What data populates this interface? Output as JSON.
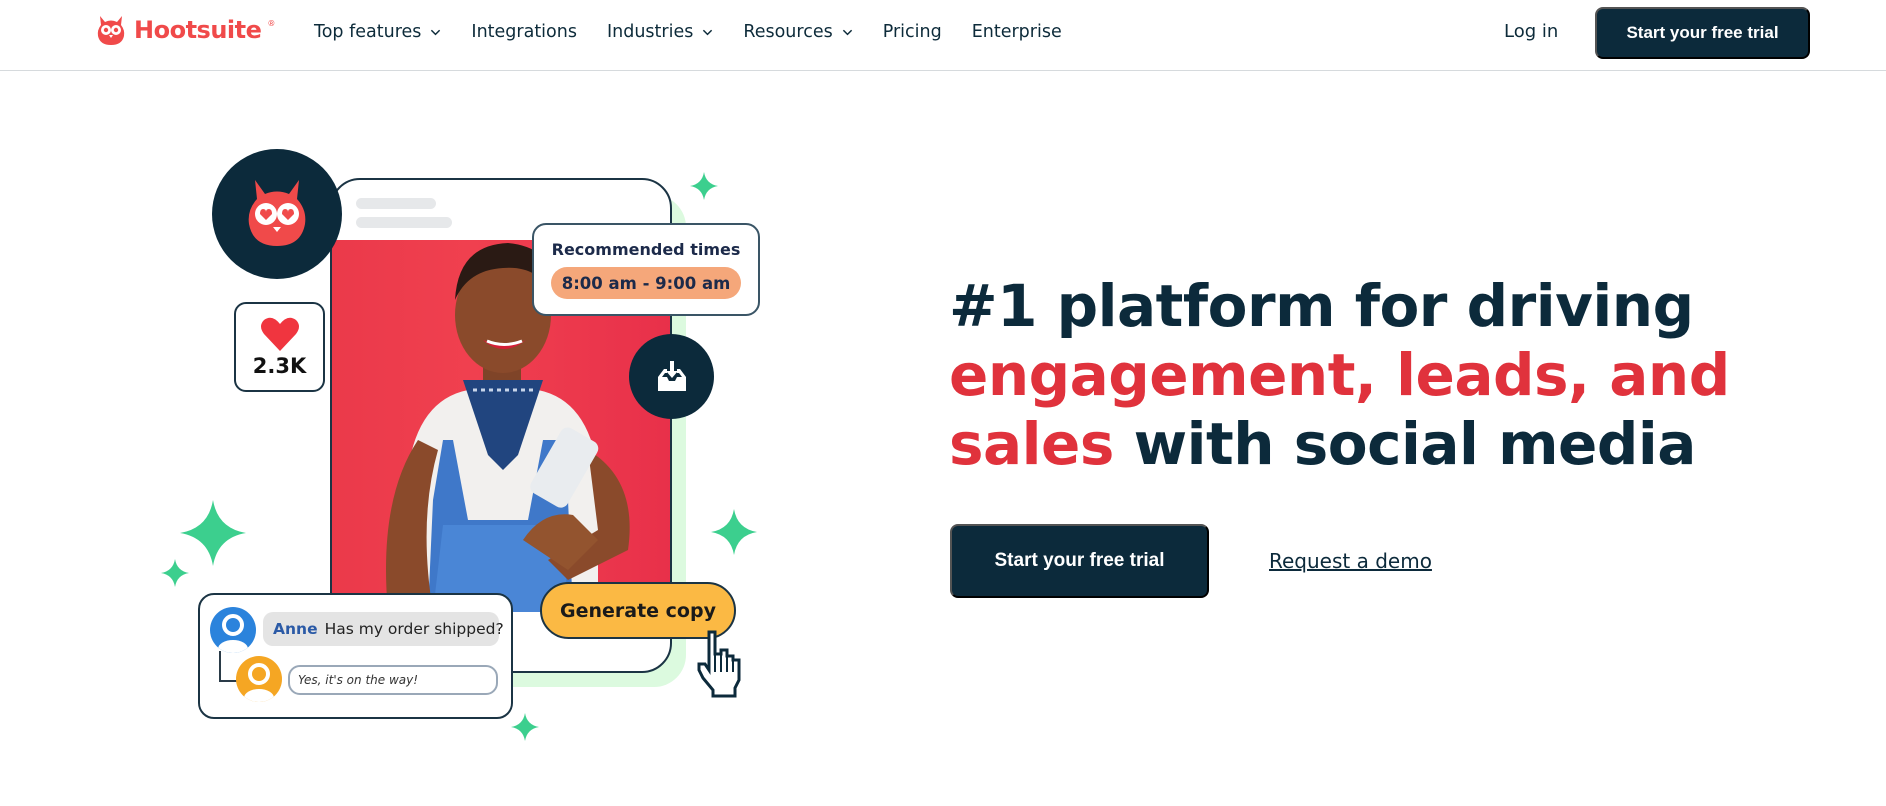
{
  "header": {
    "logo_text": "Hootsuite",
    "logo_mark": "®",
    "nav": [
      {
        "label": "Top features",
        "has_dropdown": true
      },
      {
        "label": "Integrations",
        "has_dropdown": false
      },
      {
        "label": "Industries",
        "has_dropdown": true
      },
      {
        "label": "Resources",
        "has_dropdown": true
      },
      {
        "label": "Pricing",
        "has_dropdown": false
      },
      {
        "label": "Enterprise",
        "has_dropdown": false
      }
    ],
    "login_label": "Log in",
    "trial_label": "Start your free trial"
  },
  "hero": {
    "headline_line1": "#1 platform for driving",
    "headline_red_line2": "engagement, leads, and",
    "headline_red_line3": "sales",
    "headline_rest_line3": " with social media",
    "cta_label": "Start your free trial",
    "demo_label": "Request a demo"
  },
  "illustration": {
    "likes_count": "2.3K",
    "recommended_title": "Recommended times",
    "recommended_range": "8:00 am - 9:00 am",
    "chat_name": "Anne",
    "chat_message": "Has my order shipped?",
    "chat_reply": "Yes, it's on the way!",
    "generate_label": "Generate copy"
  },
  "colors": {
    "brand_dark": "#0c2a3b",
    "brand_red": "#e0323c",
    "logo_red": "#f04a4a",
    "sparkle_green": "#3ccf8e",
    "generate_yellow": "#fbb944",
    "time_pill_orange": "#f5a77a"
  }
}
